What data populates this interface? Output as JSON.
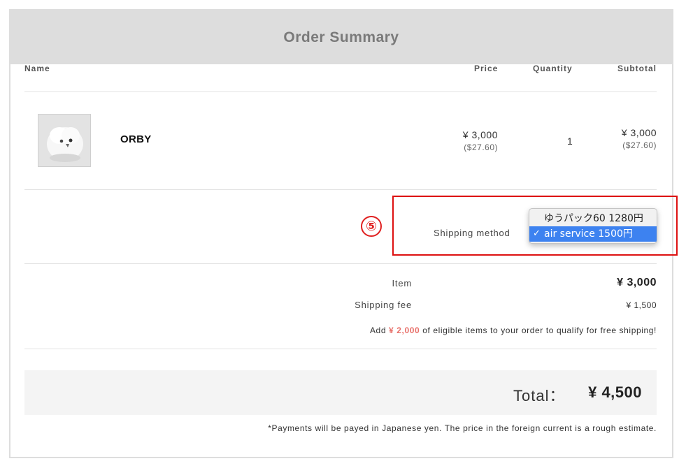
{
  "header": {
    "title": "Order Summary"
  },
  "columns": {
    "name": "Name",
    "price": "Price",
    "quantity": "Quantity",
    "subtotal": "Subtotal"
  },
  "item": {
    "name": "ORBY",
    "price": "¥ 3,000",
    "price_usd": "($27.60)",
    "quantity": "1",
    "subtotal": "¥ 3,000",
    "subtotal_usd": "($27.60)"
  },
  "shipping": {
    "step_marker": "⑤",
    "label": "Shipping method",
    "options": [
      "ゆうパック60 1280円",
      "air service 1500円"
    ],
    "selected": "air service 1500円",
    "check_glyph": "✓"
  },
  "summary": {
    "item_label": "Item",
    "item_value": "¥ 3,000",
    "fee_label": "Shipping fee",
    "fee_value": "¥ 1,500",
    "free_ship_prefix": "Add ",
    "free_ship_amount": "¥ 2,000",
    "free_ship_suffix": " of eligible items to your order to qualify for free shipping!"
  },
  "total": {
    "label": "Total：",
    "value": "¥ 4,500"
  },
  "note": "*Payments will be payed in Japanese yen. The price in the foreign current is a rough estimate.",
  "colors": {
    "accent_red": "#dd1111",
    "highlight_blue": "#3d82f0",
    "free_amount": "#e8706a",
    "header_bg": "#dddddd"
  }
}
